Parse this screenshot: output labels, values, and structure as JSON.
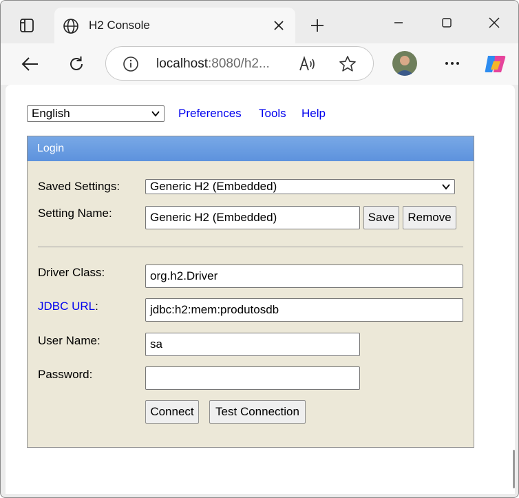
{
  "browser": {
    "tab_title": "H2 Console",
    "url_host": "localhost",
    "url_rest": ":8080/h2...",
    "icons": [
      "tab-actions-icon",
      "globe-icon",
      "close-icon",
      "plus-icon",
      "minimize-icon",
      "maximize-icon",
      "window-close-icon",
      "back-icon",
      "refresh-icon",
      "info-icon",
      "read-aloud-icon",
      "favorite-star-icon",
      "more-icon",
      "copilot-icon"
    ]
  },
  "topnav": {
    "language": "English",
    "links": [
      "Preferences",
      "Tools",
      "Help"
    ]
  },
  "login": {
    "header": "Login",
    "saved_settings_label": "Saved Settings:",
    "saved_settings_value": "Generic H2 (Embedded)",
    "setting_name_label": "Setting Name:",
    "setting_name_value": "Generic H2 (Embedded)",
    "save_label": "Save",
    "remove_label": "Remove",
    "driver_class_label": "Driver Class:",
    "driver_class_value": "org.h2.Driver",
    "jdbc_url_label": "JDBC URL",
    "jdbc_url_colon": ":",
    "jdbc_url_value": "jdbc:h2:mem:produtosdb",
    "user_name_label": "User Name:",
    "user_name_value": "sa",
    "password_label": "Password:",
    "password_value": "",
    "connect_label": "Connect",
    "test_connection_label": "Test Connection"
  },
  "colors": {
    "panel_bg": "#ece8d8",
    "panel_header": "#5d92dd",
    "link": "#0000ee"
  }
}
